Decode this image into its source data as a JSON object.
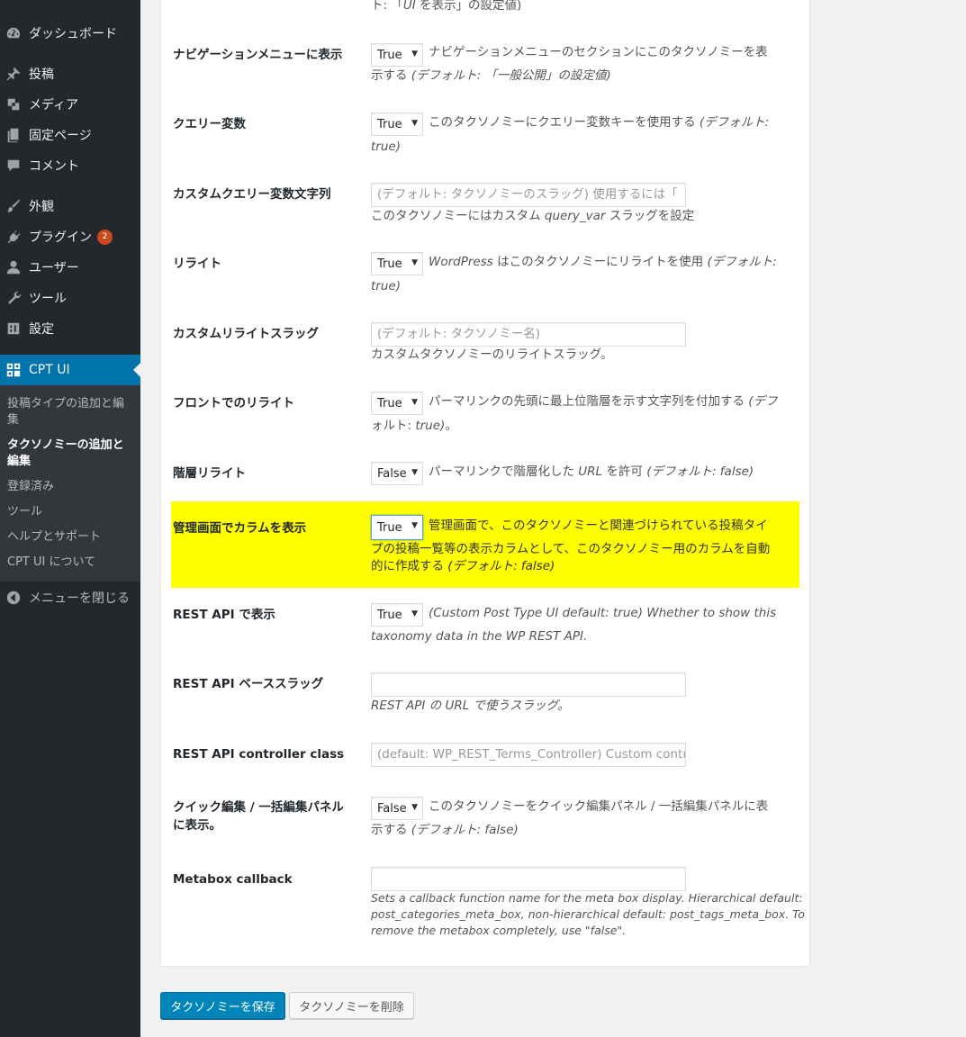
{
  "sidebar": {
    "items": [
      {
        "label": "ダッシュボード",
        "icon": "dashboard-icon"
      },
      {
        "label": "投稿",
        "icon": "pin-icon"
      },
      {
        "label": "メディア",
        "icon": "media-icon"
      },
      {
        "label": "固定ページ",
        "icon": "page-icon"
      },
      {
        "label": "コメント",
        "icon": "comment-icon"
      },
      {
        "label": "外観",
        "icon": "brush-icon"
      },
      {
        "label": "プラグイン",
        "icon": "plugin-icon",
        "badge": "2"
      },
      {
        "label": "ユーザー",
        "icon": "user-icon"
      },
      {
        "label": "ツール",
        "icon": "wrench-icon"
      },
      {
        "label": "設定",
        "icon": "settings-icon"
      },
      {
        "label": "CPT UI",
        "icon": "cptui-icon"
      }
    ],
    "submenu": [
      "投稿タイプの追加と編集",
      "タクソノミーの追加と編集",
      "登録済み",
      "ツール",
      "ヘルプとサポート",
      "CPT UI について"
    ],
    "collapse": "メニューを閉じる"
  },
  "rows": {
    "top_desc": "ト: 「",
    "top_desc_it": "UI",
    "top_desc_rest": " を表示」の設定値)",
    "show_in_nav": {
      "label": "ナビゲーションメニューに表示",
      "value": "True",
      "desc1": "ナビゲーションメニューのセクションにこのタクソノミーを表",
      "desc2": "示する ",
      "desc2_it": "(デフォルト: 「一般公開」の設定値)"
    },
    "query_var": {
      "label": "クエリー変数",
      "value": "True",
      "desc1": "このタクソノミーにクエリー変数キーを使用する ",
      "desc1_it": "(デフォルト:",
      "desc2_it": "true)"
    },
    "query_var_slug": {
      "label": "カスタムクエリー変数文字列",
      "placeholder": "(デフォルト: タクソノミーのスラッグ) 使用するには「",
      "desc1": "このタクソノミーにはカスタム ",
      "desc1_it": "query_var",
      "desc1_rest": " スラッグを設定"
    },
    "rewrite": {
      "label": "リライト",
      "value": "True",
      "desc1_it": "WordPress",
      "desc1": " はこのタクソノミーにリライトを使用 ",
      "desc1_it2": "(デフォルト:",
      "desc2_it": "true)"
    },
    "rewrite_slug": {
      "label": "カスタムリライトスラッグ",
      "placeholder": "(デフォルト: タクソノミー名)",
      "desc1": "カスタムタクソノミーのリライトスラッグ。"
    },
    "rewrite_front": {
      "label": "フロントでのリライト",
      "value": "True",
      "desc1": "パーマリンクの先頭に最上位階層を示す文字列を付加する ",
      "desc1_it": "(デフ",
      "desc2": "ォルト: ",
      "desc2_it": "true)",
      "desc2_rest": "。"
    },
    "rewrite_hier": {
      "label": "階層リライト",
      "value": "False",
      "desc1": "パーマリンクで階層化した ",
      "desc1_it": "URL",
      "desc1_rest": " を許可 ",
      "desc1_it2": "(デフォルト: false)"
    },
    "show_admin_column": {
      "label": "管理画面でカラムを表示",
      "value": "True",
      "desc1": "管理画面で、このタクソノミーと関連づけられている投稿タイ",
      "desc2": "プの投稿一覧等の表示カラムとして、このタクソノミー用のカラムを自動",
      "desc3": "的に作成する ",
      "desc3_it": "(デフォルト: false)",
      "highlight": "#ffff00"
    },
    "show_in_rest": {
      "label": "REST API で表示",
      "value": "True",
      "desc1_it": "(Custom Post Type UI default: true) Whether to show this",
      "desc2_it": "taxonomy data in the WP REST API."
    },
    "rest_base": {
      "label": "REST API ベーススラッグ",
      "placeholder": "",
      "desc1_it": "REST API の URL で使うスラッグ。"
    },
    "rest_controller": {
      "label": "REST API controller class",
      "placeholder": "(default: WP_REST_Terms_Controller) Custom controller"
    },
    "quick_edit": {
      "label1": "クイック編集 / 一括編集パネル",
      "label2": "に表示。",
      "value": "False",
      "desc1": "このタクソノミーをクイック編集パネル / 一括編集パネルに表",
      "desc2": "示する ",
      "desc2_it": "(デフォルト: false)"
    },
    "metabox": {
      "label": "Metabox callback",
      "placeholder": "",
      "desc1_it": "Sets a callback function name for the meta box display. Hierarchical default:",
      "desc2_it": "post_categories_meta_box, non-hierarchical default: post_tags_meta_box. To",
      "desc3_it": "remove the metabox completely, use \"false\"."
    }
  },
  "buttons": {
    "save": "タクソノミーを保存",
    "delete": "タクソノミーを削除"
  },
  "colors": {
    "accent": "#0073aa",
    "primary_button": "#0085ba",
    "highlight": "#ffff00"
  }
}
